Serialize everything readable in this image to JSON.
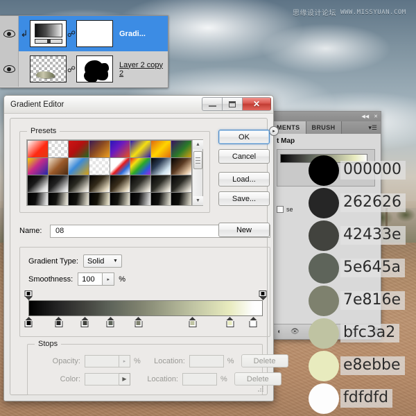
{
  "watermark": {
    "cn": "思缘设计论坛",
    "en": "WWW.MISSYUAN.COM"
  },
  "layers_panel": {
    "rows": [
      {
        "name": "Gradi...",
        "eye_icon": "eye-icon",
        "link_icon": "link-icon",
        "clip_icon": "clipping-arrow-icon",
        "selected": true
      },
      {
        "name": "Layer 2 copy 2",
        "eye_icon": "eye-icon",
        "link_icon": "link-icon",
        "selected": false
      }
    ]
  },
  "gradient_editor": {
    "title": "Gradient Editor",
    "window_buttons": {
      "minimize": "minimize-icon",
      "maximize": "maximize-icon",
      "close": "✕"
    },
    "presets": {
      "label": "Presets",
      "gear_icon": "▸",
      "scroll_up": "▲",
      "scroll_down": "▼",
      "swatches": [
        "linear-gradient(135deg,#ffffff 0%, #ff2a12 58%, #e03a12 100%)",
        "repeating-conic-gradient(#ffffff 0% 25%, #d8d8d8 0% 50%) 0 0/9px 9px",
        "linear-gradient(135deg,#cf1414 0%, #b21010 45%, #1f6b22 100%)",
        "linear-gradient(135deg,#3b1a55 0%, #8a4a22 45%, #f0a020 100%)",
        "linear-gradient(135deg,#2a15b8 0%, #6a1ac0 40%, #e8521a 100%)",
        "linear-gradient(135deg,#2a15b8 0%, #f5e010 50%, #2a15b8 100%)",
        "linear-gradient(135deg,#e06a10 0%, #ffd400 50%, #e06a10 100%)",
        "linear-gradient(135deg,#3a1060 0%, #2a7a2a 55%, #d8a010 100%)",
        "linear-gradient(135deg,#f2d400 0%, #c42a8a 45%, #1f2aa8 100%)",
        "linear-gradient(135deg,#f0e4d0 0%, #9a5a2a 50%, #4a2a12 100%)",
        "linear-gradient(135deg,#f0f0f0 0%, #3a8ad8 42%, #d8a010 100%)",
        "repeating-conic-gradient(#ffffff 0% 25%, #e4e4e4 0% 50%) 0 0/9px 9px",
        "linear-gradient(135deg,#ffffff 0%, #ffffff 38%, #e81a1a 52%, #2a6ad8 72%, #ffffff 100%)",
        "linear-gradient(135deg,#e81a1a 0%, #f5e010 25%, #2aa82a 50%, #2a5ad8 75%, #a82ad8 100%)",
        "linear-gradient(135deg,#000000 0%, #2a3a52 35%, #cfe2ee 75%, #ffffff 100%)",
        "linear-gradient(135deg,#000000 0%, #5a3a22 45%, #e0c2a0 80%, #ffffff 100%)",
        "linear-gradient(135deg,#000000 0%, #1a1a1a 40%, #d8d8d8 80%, #ffffff 100%)",
        "linear-gradient(135deg,#000000 0%, #222222 42%, #cccccc 82%, #ffffff 100%)",
        "linear-gradient(135deg,#000000 0%, #2a2a22 42%, #d0ccc0 82%, #ffffff 100%)",
        "linear-gradient(135deg,#000000 0%, #332a1a 42%, #ddd2b8 82%, #ffffff 100%)",
        "linear-gradient(135deg,#000000 0%, #3a2e1c 45%, #e0d4ba 84%, #ffffff 100%)",
        "linear-gradient(135deg,#000000 0%, #30302a 45%, #d4d0c4 84%, #ffffff 100%)",
        "linear-gradient(135deg,#000000 0%, #2c2c26 45%, #d6d2c6 84%, #ffffff 100%)",
        "linear-gradient(135deg,#000000 0%, #2a2a24 45%, #d2cec2 84%, #ffffff 100%)",
        "linear-gradient(100deg,#000000 0%, #0d0d0d 40%, #cfcfcf 85%, #f4f4f4 100%)",
        "linear-gradient(100deg,#000000 0%, #131310 40%, #cfccc0 85%, #f2f0e6 100%)",
        "linear-gradient(100deg,#000000 0%, #12120e 40%, #c8c4b6 85%, #efece0 100%)",
        "linear-gradient(100deg,#000000 0%, #151208 40%, #cdc7b0 85%, #f0ecdc 100%)",
        "linear-gradient(100deg,#000000 0%, #14140f 40%, #c6c2b2 85%, #eeebe0 100%)",
        "linear-gradient(100deg,#000000 0%, #101010 40%, #c4c4c4 85%, #ececec 100%)",
        "linear-gradient(100deg,#000000 0%, #121210 40%, #c2c0b4 85%, #eae8dc 100%)",
        "linear-gradient(100deg,#000000 0%, #0f0f0c 40%, #c0bdb0 85%, #e8e6d8 100%)"
      ]
    },
    "buttons": {
      "ok": "OK",
      "cancel": "Cancel",
      "load": "Load...",
      "save": "Save...",
      "new": "New"
    },
    "name": {
      "label": "Name:",
      "value": "08"
    },
    "gradient_type": {
      "label": "Gradient Type:",
      "value": "Solid",
      "caret": "▼"
    },
    "smoothness": {
      "label": "Smoothness:",
      "value": "100",
      "unit": "%",
      "stepper": "▸"
    },
    "bar": {
      "css": "linear-gradient(90deg,#000000 0%, #262626 13%, #42433e 24%, #5e645a 35%, #7e816e 47%, #bfc3a2 70%, #e8ebbe 86%, #fdfdfd 96%, #ffffff 100%)",
      "opacity_stops": [
        {
          "location": 0
        },
        {
          "location": 100
        }
      ],
      "color_stops": [
        {
          "location": 0,
          "color": "#000000"
        },
        {
          "location": 13,
          "color": "#262626"
        },
        {
          "location": 24,
          "color": "#42433e"
        },
        {
          "location": 35,
          "color": "#5e645a"
        },
        {
          "location": 47,
          "color": "#7e816e"
        },
        {
          "location": 70,
          "color": "#bfc3a2"
        },
        {
          "location": 86,
          "color": "#e8ebbe"
        },
        {
          "location": 96,
          "color": "#fdfdfd"
        }
      ]
    },
    "stops": {
      "label": "Stops",
      "opacity_label": "Opacity:",
      "opacity_value": "",
      "color_label": "Color:",
      "location_label": "Location:",
      "location_value": "",
      "percent": "%",
      "delete_label": "Delete",
      "stepper": "▸",
      "color_caret": "▶"
    }
  },
  "adjustments_panel": {
    "tabs": [
      {
        "label": "MENTS",
        "active": true
      },
      {
        "label": "BRUSH",
        "active": false
      }
    ],
    "collapse_icon": "◀◀",
    "close_icon": "✕",
    "menu_icon": "▾☰",
    "heading": "t Map",
    "gradient_preview_css": "linear-gradient(90deg,#000000 0%, #262626 13%, #42433e 24%, #5e645a 35%, #7e816e 47%, #bfc3a2 70%, #e8ebbe 86%, #fdfdfd 100%)",
    "reverse_label": "se",
    "footer_icons": [
      "clip-to-layer-icon",
      "eye-icon",
      "reset-icon",
      "delete-icon"
    ]
  },
  "swatch_list": [
    {
      "hex": "000000",
      "css": "#000000"
    },
    {
      "hex": "262626",
      "css": "#262626"
    },
    {
      "hex": "42433e",
      "css": "#42433e"
    },
    {
      "hex": "5e645a",
      "css": "#5e645a"
    },
    {
      "hex": "7e816e",
      "css": "#7e816e"
    },
    {
      "hex": "bfc3a2",
      "css": "#bfc3a2"
    },
    {
      "hex": "e8ebbe",
      "css": "#e8ebbe"
    },
    {
      "hex": "fdfdfd",
      "css": "#fdfdfd"
    }
  ]
}
